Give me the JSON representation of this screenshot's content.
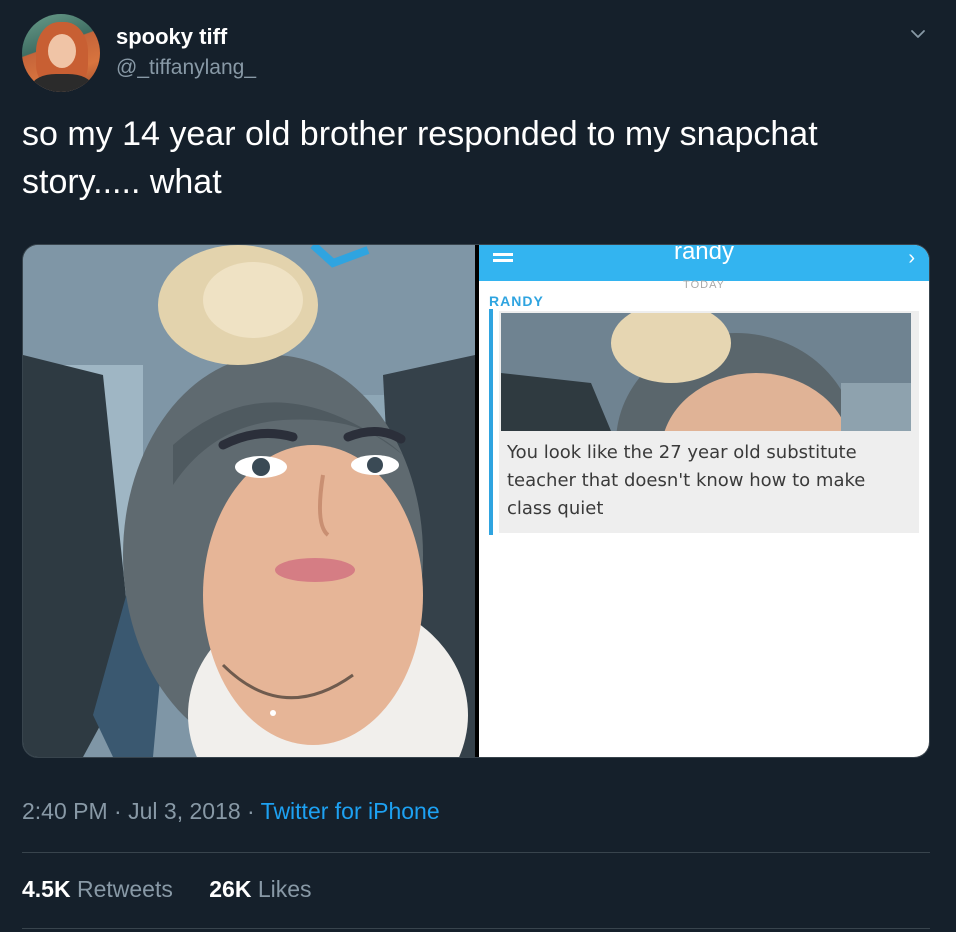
{
  "author": {
    "display_name": "spooky tiff",
    "handle": "@_tiffanylang_"
  },
  "tweet": {
    "text": "so my 14 year old brother responded to my snapchat story..... what"
  },
  "media": {
    "snapchat": {
      "chat_title": "randy",
      "day_label": "TODAY",
      "sender_label": "RANDY",
      "reply_text": "You look like the 27 year old substitute teacher that doesn't know how to make class quiet"
    }
  },
  "meta": {
    "time": "2:40 PM",
    "separator1": " · ",
    "date": "Jul 3, 2018",
    "separator2": " · ",
    "source": "Twitter for iPhone"
  },
  "stats": {
    "retweets_count": "4.5K",
    "retweets_label": "Retweets",
    "likes_count": "26K",
    "likes_label": "Likes"
  },
  "colors": {
    "background": "#15202b",
    "secondary_text": "#8899a6",
    "link": "#1da1f2",
    "snapchat_blue": "#33b4f0"
  },
  "icons": {
    "caret": "chevron-down-icon",
    "menu": "hamburger-menu-icon",
    "forward": "chevron-right-icon"
  }
}
